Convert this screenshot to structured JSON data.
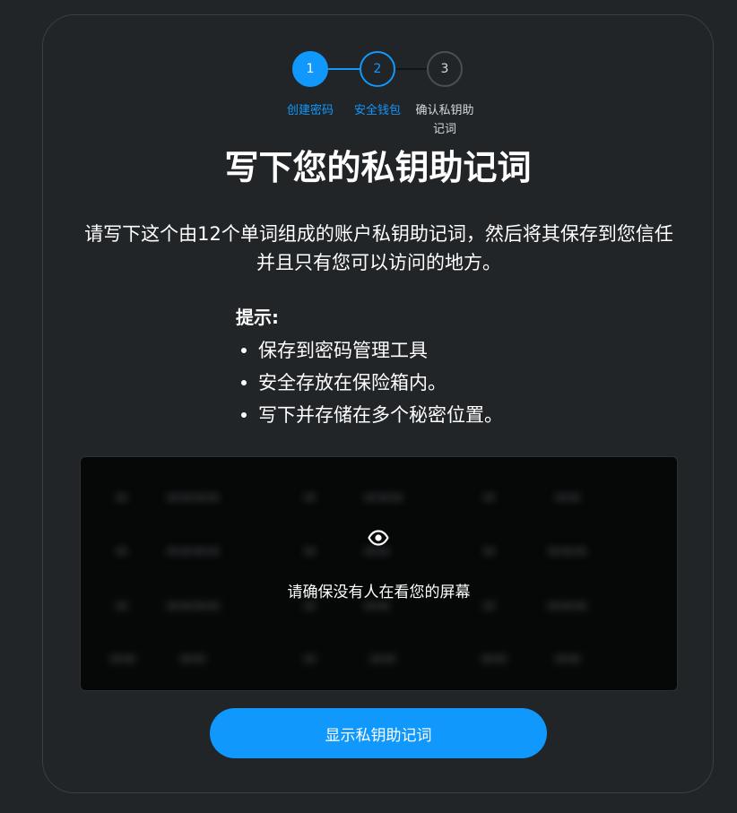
{
  "stepper": {
    "steps": [
      {
        "number": "1",
        "label": "创建密码",
        "state": "completed"
      },
      {
        "number": "2",
        "label": "安全钱包",
        "state": "active"
      },
      {
        "number": "3",
        "label": "确认私钥助\n记词",
        "state": "upcoming"
      }
    ]
  },
  "title": "写下您的私钥助记词",
  "description": "请写下这个由12个单词组成的账户私钥助记词，然后将其保存到您信任并且只有您可以访问的地方。",
  "tips": {
    "heading": "提示:",
    "items": [
      "保存到密码管理工具",
      "安全存放在保险箱内。",
      "写下并存储在多个秘密位置。"
    ]
  },
  "phrase_box": {
    "icon": "eye-icon",
    "warning_text": "请确保没有人在看您的屏幕",
    "blurred": true
  },
  "reveal_button": {
    "label": "显示私钥助记词"
  },
  "colors": {
    "background": "#222528",
    "accent": "#1098fc",
    "text": "#ffffff",
    "phrase_box_bg": "#060707"
  }
}
